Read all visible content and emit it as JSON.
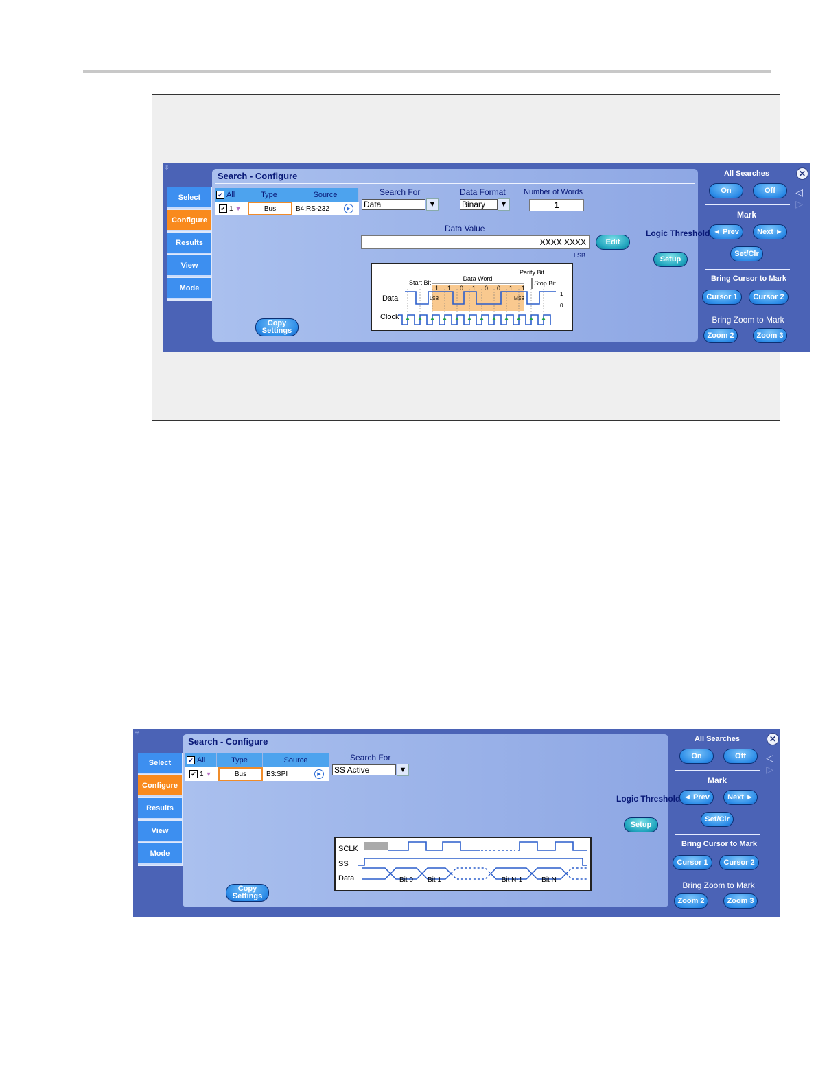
{
  "panel1": {
    "title": "Search - Configure",
    "tabs": [
      "Select",
      "Configure",
      "Results",
      "View",
      "Mode"
    ],
    "table": {
      "all_label": "All",
      "type_header": "Type",
      "source_header": "Source",
      "row_num": "1",
      "type_value": "Bus",
      "source_value": "B4:RS-232"
    },
    "search_for_label": "Search For",
    "search_for_value": "Data",
    "data_format_label": "Data Format",
    "data_format_value": "Binary",
    "num_words_label": "Number of Words",
    "num_words_value": "1",
    "data_value_label": "Data Value",
    "data_value": "XXXX XXXX",
    "lsb_label": "LSB",
    "edit_label": "Edit",
    "logic_thresholds_label": "Logic Thresholds",
    "setup_label": "Setup",
    "copy_settings_label": "Copy Settings",
    "diagram": {
      "data_word": "Data Word",
      "parity_bit": "Parity Bit",
      "start_bit": "Start Bit",
      "stop_bit": "Stop Bit",
      "data": "Data",
      "clock": "Clock",
      "lsb": "LSB",
      "msb": "MSB",
      "one": "1",
      "zero": "0",
      "bits": [
        "1",
        "1",
        "0",
        "1",
        "0",
        "0",
        "1",
        "1"
      ]
    }
  },
  "panel2": {
    "title": "Search - Configure",
    "tabs": [
      "Select",
      "Configure",
      "Results",
      "View",
      "Mode"
    ],
    "table": {
      "all_label": "All",
      "type_header": "Type",
      "source_header": "Source",
      "row_num": "1",
      "type_value": "Bus",
      "source_value": "B3:SPI"
    },
    "search_for_label": "Search For",
    "search_for_value": "SS Active",
    "logic_thresholds_label": "Logic Thresholds",
    "setup_label": "Setup",
    "copy_settings_label": "Copy Settings",
    "diagram": {
      "sclk": "SCLK",
      "ss": "SS",
      "data": "Data",
      "bit0": "Bit 0",
      "bit1": "Bit 1",
      "bitn1": "Bit N-1",
      "bitn": "Bit N"
    }
  },
  "sidebar": {
    "all_searches": "All Searches",
    "on": "On",
    "off": "Off",
    "mark": "Mark",
    "prev": "◄ Prev",
    "next": "Next ►",
    "setclr": "Set/Clr",
    "bring_cursor": "Bring Cursor to Mark",
    "cursor1": "Cursor 1",
    "cursor2": "Cursor 2",
    "bring_zoom": "Bring Zoom to Mark",
    "zoom2": "Zoom 2",
    "zoom3": "Zoom 3"
  },
  "icons": [
    "close-icon",
    "nav-left-icon",
    "nav-right-icon",
    "play-icon",
    "dropdown-arrow-icon",
    "checkbox-icon"
  ],
  "colors": {
    "screen_bg": "#4b63b6",
    "tab_active": "#f98a1d",
    "tab": "#3d8ff0",
    "button": "#2d8de8",
    "title": "#0a1a78"
  }
}
